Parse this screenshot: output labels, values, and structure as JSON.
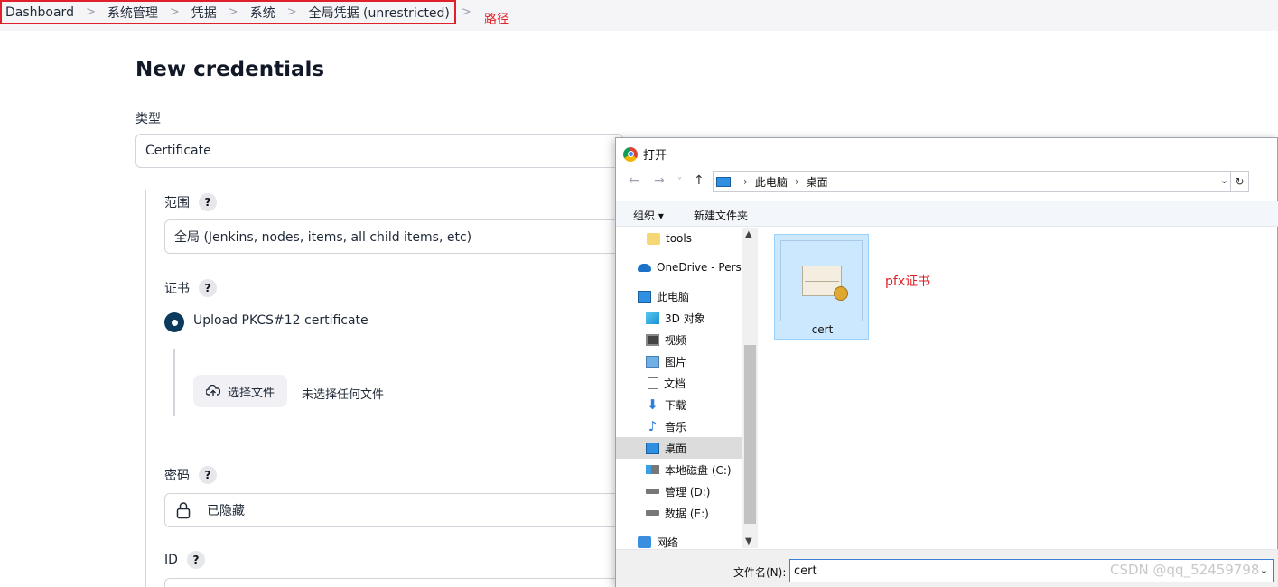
{
  "breadcrumb": {
    "items": [
      "Dashboard",
      "系统管理",
      "凭据",
      "系统",
      "全局凭据 (unrestricted)"
    ],
    "separator": ">",
    "annotation": "路径"
  },
  "page": {
    "title": "New credentials"
  },
  "form": {
    "type_label": "类型",
    "type_value": "Certificate",
    "scope_label": "范围",
    "scope_value": "全局 (Jenkins, nodes, items, all child items, etc)",
    "cert_label": "证书",
    "cert_option": "Upload PKCS#12 certificate",
    "upload_button": "选择文件",
    "upload_status": "未选择任何文件",
    "password_label": "密码",
    "password_value": "已隐藏",
    "id_label": "ID",
    "help": "?"
  },
  "dialog": {
    "title": "打开",
    "address": [
      "此电脑",
      "桌面"
    ],
    "toolbar": {
      "organize": "组织 ▾",
      "new_folder": "新建文件夹"
    },
    "nav_items": [
      {
        "label": "tools",
        "icon": "folder-icon"
      },
      {
        "label": "OneDrive - Personal",
        "icon": "onedrive-icon"
      },
      {
        "label": "此电脑",
        "icon": "this-pc-icon"
      },
      {
        "label": "3D 对象",
        "icon": "3d-objects-icon"
      },
      {
        "label": "视频",
        "icon": "videos-icon"
      },
      {
        "label": "图片",
        "icon": "pictures-icon"
      },
      {
        "label": "文档",
        "icon": "documents-icon"
      },
      {
        "label": "下载",
        "icon": "downloads-icon"
      },
      {
        "label": "音乐",
        "icon": "music-icon"
      },
      {
        "label": "桌面",
        "icon": "desktop-icon"
      },
      {
        "label": "本地磁盘 (C:)",
        "icon": "drive-c-icon"
      },
      {
        "label": "管理 (D:)",
        "icon": "drive-d-icon"
      },
      {
        "label": "数据 (E:)",
        "icon": "drive-e-icon"
      },
      {
        "label": "网络",
        "icon": "network-icon"
      }
    ],
    "file": {
      "name": "cert",
      "annotation": "pfx证书"
    },
    "filename_label": "文件名(N):",
    "filename_value": "cert"
  },
  "watermark": "CSDN @qq_52459798",
  "colors": {
    "highlight_red": "#e0202a",
    "radio_selected": "#0b3a5c",
    "file_selected_bg": "#cce8ff"
  }
}
